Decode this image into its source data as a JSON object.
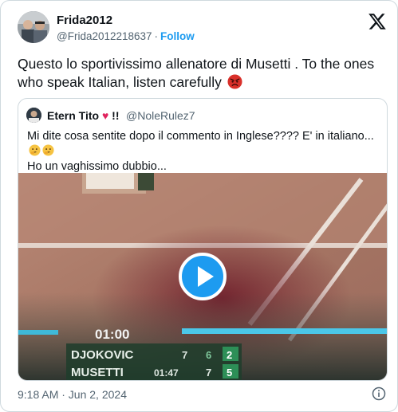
{
  "author": {
    "display_name": "Frida2012",
    "handle": "@Frida2012218637",
    "separator": "·",
    "follow_label": "Follow"
  },
  "tweet": {
    "text": "Questo lo sportivissimo allenatore di Musetti . To the ones who speak Italian, listen carefully",
    "emoji_icon": "angry-face-icon"
  },
  "quoted": {
    "name": "Etern Tito",
    "heart": "♥",
    "bangs": "!!",
    "handle": "@NoleRulez7",
    "text": "Mi dite cosa sentite dopo il commento in Inglese???? E' in italiano...",
    "text_line2": "Ho un vaghissimo dubbio...",
    "emoji_icon": "thinking-face-icon"
  },
  "video": {
    "scoreboard": {
      "time": "01:00",
      "player1": "DJOKOVIC",
      "player1_scores": [
        "7",
        "6",
        "2"
      ],
      "player2": "MUSETTI",
      "player2_time": "01:47",
      "player2_scores": [
        "7",
        "5"
      ]
    }
  },
  "footer": {
    "timestamp": "9:18 AM · Jun 2, 2024"
  },
  "colors": {
    "accent": "#1d9bf0",
    "secondary_text": "#536471",
    "border": "#cfd9de"
  }
}
